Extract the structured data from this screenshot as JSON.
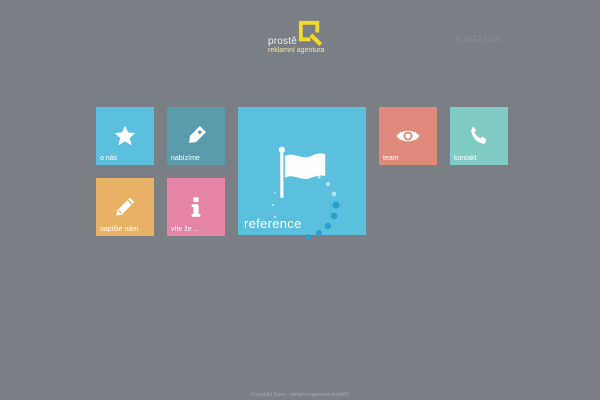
{
  "brand": {
    "word": "prostě",
    "subtitle": "reklamní agentura",
    "logo_icon": "q-square-logo-icon",
    "logo_color": "#f5d928"
  },
  "nav": {
    "faint_text": "ENGLISH"
  },
  "tiles": [
    {
      "label": "o nás",
      "icon": "star-icon",
      "color": "#5bc0de"
    },
    {
      "label": "nabízíme",
      "icon": "tag-icon",
      "color": "#5a9bab"
    },
    {
      "label": "reference",
      "icon": "flag-icon",
      "color": "#5bc0de"
    },
    {
      "label": "team",
      "icon": "eye-icon",
      "color": "#e08a7c"
    },
    {
      "label": "kontakt",
      "icon": "phone-icon",
      "color": "#80cbc4"
    },
    {
      "label": "napište nám",
      "icon": "pencil-icon",
      "color": "#e8b266"
    },
    {
      "label": "víte že ...",
      "icon": "info-icon",
      "color": "#e684a8"
    }
  ],
  "footer": {
    "text": "Copyright Dave - reklamní agentura prostěQ"
  }
}
